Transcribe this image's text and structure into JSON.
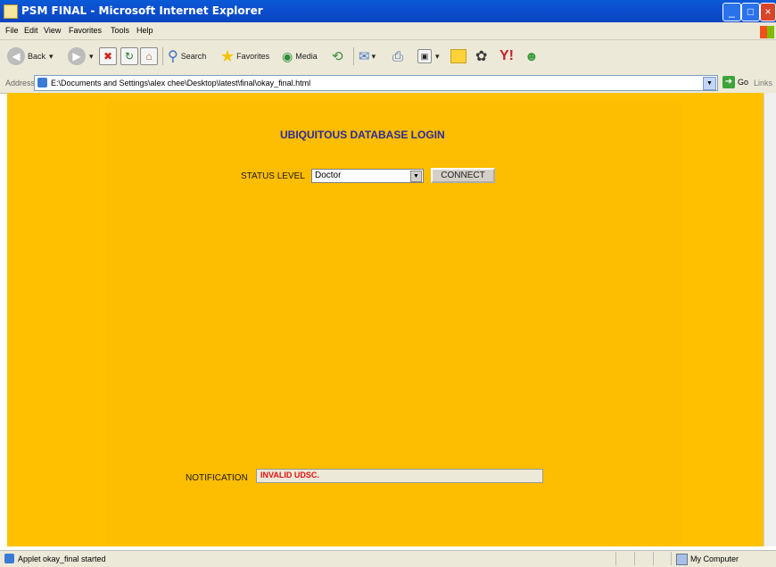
{
  "window": {
    "title": "PSM FINAL - Microsoft Internet Explorer"
  },
  "menu": [
    "File",
    "Edit",
    "View",
    "Favorites",
    "Tools",
    "Help"
  ],
  "toolbar": {
    "back": "Back",
    "search": "Search",
    "favorites": "Favorites",
    "media": "Media"
  },
  "address": {
    "label": "Address",
    "url": "E:\\Documents and Settings\\alex chee\\Desktop\\latest\\final\\okay_final.html",
    "go": "Go",
    "links": "Links"
  },
  "page": {
    "heading": "UBIQUITOUS DATABASE LOGIN",
    "status_label": "STATUS LEVEL",
    "status_value": "Doctor",
    "connect": "CONNECT",
    "notification_label": "NOTIFICATION",
    "notification_value": "INVALID UDSC."
  },
  "statusbar": {
    "text": "Applet okay_final started",
    "zone": "My Computer"
  },
  "colors": {
    "page_background": "#ffc000",
    "heading": "#2b2b9a",
    "notification_text": "#e01010"
  }
}
